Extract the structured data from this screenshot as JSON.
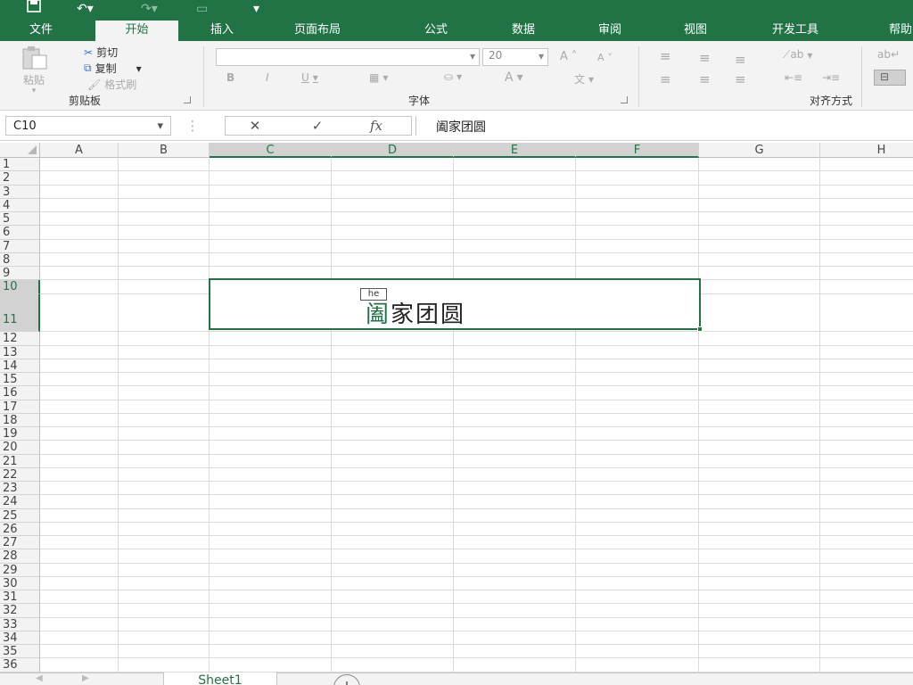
{
  "qat": {
    "save_icon": "save-icon",
    "undo_icon": "undo-icon",
    "redo_icon": "redo-icon",
    "camera_icon": "camera-icon",
    "customize_icon": "qat-dropdown-icon"
  },
  "tabs": [
    "文件",
    "开始",
    "插入",
    "页面布局",
    "公式",
    "数据",
    "审阅",
    "视图",
    "开发工具",
    "帮助"
  ],
  "active_tab": "开始",
  "ribbon": {
    "clipboard": {
      "title": "剪贴板",
      "paste": "粘贴",
      "cut": "剪切",
      "copy": "复制",
      "format_painter": "格式刷"
    },
    "font": {
      "title": "字体",
      "font_name": "",
      "font_size": "20",
      "bold": "B",
      "italic": "I",
      "underline": "U",
      "font_color": "A",
      "wen": "文",
      "grow": "A",
      "shrink": "A"
    },
    "alignment": {
      "title": "对齐方式"
    }
  },
  "formula_bar": {
    "name_box": "C10",
    "cancel": "✕",
    "confirm": "✓",
    "fx": "fx",
    "content": "阖家团圆"
  },
  "columns": [
    "A",
    "B",
    "C",
    "D",
    "E",
    "F",
    "G",
    "H"
  ],
  "rows": [
    "1",
    "2",
    "3",
    "4",
    "5",
    "6",
    "7",
    "8",
    "9",
    "10",
    "11",
    "12",
    "13",
    "14",
    "15",
    "16",
    "17",
    "18",
    "19",
    "20",
    "21",
    "22",
    "23",
    "24",
    "25",
    "26",
    "27",
    "28",
    "29",
    "30",
    "31",
    "32",
    "33",
    "34",
    "35",
    "36"
  ],
  "cell": {
    "ime_hint": "he",
    "first_char": "阖",
    "rest": "家团圆"
  },
  "colors": {
    "accent": "#217346",
    "ribbon_bg": "#f3f3f3"
  },
  "sheets": [
    "Sheet1"
  ],
  "add_sheet": "+"
}
